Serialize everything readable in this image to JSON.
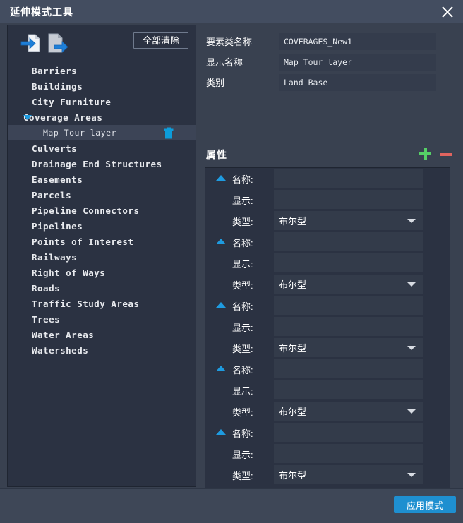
{
  "window": {
    "title": "延伸模式工具",
    "close_icon": "close-icon"
  },
  "left_panel": {
    "toolbar": {
      "import_icon": "document-import-icon",
      "export_icon": "document-export-icon",
      "clear_all_label": "全部清除"
    },
    "tree": [
      {
        "label": "Barriers",
        "level": 0,
        "expandable": false,
        "selected": false
      },
      {
        "label": "Buildings",
        "level": 0,
        "expandable": false,
        "selected": false
      },
      {
        "label": "City Furniture",
        "level": 0,
        "expandable": false,
        "selected": false
      },
      {
        "label": "Coverage Areas",
        "level": 0,
        "expandable": true,
        "selected": false
      },
      {
        "label": "Map Tour layer",
        "level": 1,
        "expandable": false,
        "selected": true,
        "delete_icon": "trash-icon"
      },
      {
        "label": "Culverts",
        "level": 0,
        "expandable": false,
        "selected": false
      },
      {
        "label": "Drainage End Structures",
        "level": 0,
        "expandable": false,
        "selected": false
      },
      {
        "label": "Easements",
        "level": 0,
        "expandable": false,
        "selected": false
      },
      {
        "label": "Parcels",
        "level": 0,
        "expandable": false,
        "selected": false
      },
      {
        "label": "Pipeline Connectors",
        "level": 0,
        "expandable": false,
        "selected": false
      },
      {
        "label": "Pipelines",
        "level": 0,
        "expandable": false,
        "selected": false
      },
      {
        "label": "Points of Interest",
        "level": 0,
        "expandable": false,
        "selected": false
      },
      {
        "label": "Railways",
        "level": 0,
        "expandable": false,
        "selected": false
      },
      {
        "label": "Right of Ways",
        "level": 0,
        "expandable": false,
        "selected": false
      },
      {
        "label": "Roads",
        "level": 0,
        "expandable": false,
        "selected": false
      },
      {
        "label": "Traffic Study Areas",
        "level": 0,
        "expandable": false,
        "selected": false
      },
      {
        "label": "Trees",
        "level": 0,
        "expandable": false,
        "selected": false
      },
      {
        "label": "Water Areas",
        "level": 0,
        "expandable": false,
        "selected": false
      },
      {
        "label": "Watersheds",
        "level": 0,
        "expandable": false,
        "selected": false
      }
    ]
  },
  "right_panel": {
    "fields": [
      {
        "label": "要素类名称",
        "value": "COVERAGES_New1"
      },
      {
        "label": "显示名称",
        "value": "Map Tour layer"
      },
      {
        "label": "类别",
        "value": "Land Base"
      }
    ],
    "attributes_section": {
      "title": "属性",
      "add_icon": "plus-icon",
      "remove_icon": "minus-icon",
      "name_label": "名称:",
      "display_label": "显示:",
      "type_label": "类型:",
      "type_options": [
        "布尔型"
      ],
      "rows": [
        {
          "name": "",
          "display": "",
          "type": "布尔型"
        },
        {
          "name": "",
          "display": "",
          "type": "布尔型"
        },
        {
          "name": "",
          "display": "",
          "type": "布尔型"
        },
        {
          "name": "",
          "display": "",
          "type": "布尔型"
        },
        {
          "name": "",
          "display": "",
          "type": "布尔型"
        }
      ]
    }
  },
  "footer": {
    "apply_label": "应用模式"
  },
  "colors": {
    "accent_blue": "#1e9be0",
    "apply_button": "#1e8fd0",
    "add_green": "#55d066",
    "remove_red": "#e0645f",
    "titlebar": "#434d60",
    "panel_bg": "#2b3242",
    "body_bg": "#394150"
  }
}
